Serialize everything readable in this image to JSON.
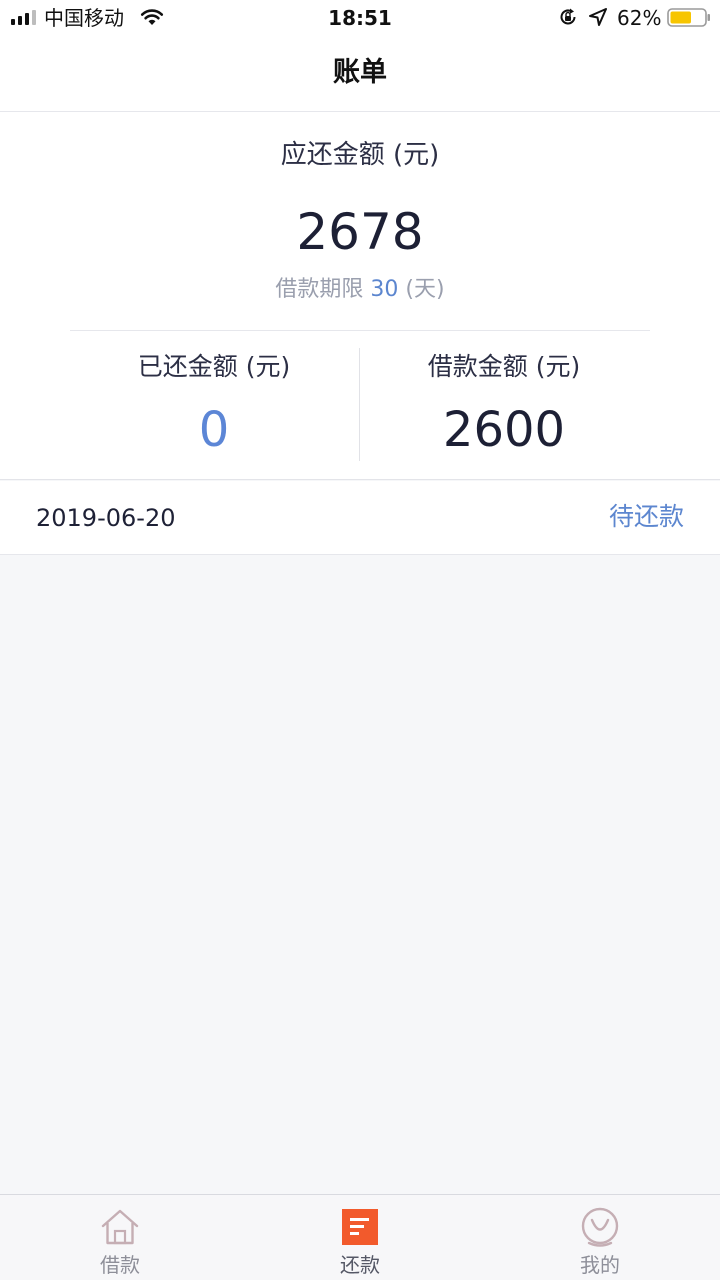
{
  "status_bar": {
    "carrier": "中国移动",
    "time": "18:51",
    "battery_percent": "62%",
    "battery_level": 0.62,
    "icons": [
      "signal-icon",
      "wifi-icon",
      "orientation-lock-icon",
      "location-arrow-icon",
      "battery-icon"
    ]
  },
  "header": {
    "title": "账单"
  },
  "summary": {
    "due_label": "应还金额 (元)",
    "due_amount": "2678",
    "term_prefix": "借款期限 ",
    "term_value": "30",
    "term_suffix": " (天)",
    "repaid_label": "已还金额 (元)",
    "repaid_value": "0",
    "loan_label": "借款金额 (元)",
    "loan_value": "2600"
  },
  "bill": {
    "date": "2019-06-20",
    "status": "待还款"
  },
  "tabs": [
    {
      "label": "借款",
      "icon": "house-icon",
      "active": false
    },
    {
      "label": "还款",
      "icon": "bill-icon",
      "active": true
    },
    {
      "label": "我的",
      "icon": "profile-icon",
      "active": false
    }
  ],
  "colors": {
    "accent_blue": "#5c86cf",
    "active_tab_orange": "#f25a2c",
    "text_dark": "#1e2136",
    "text_muted": "#9a9fae",
    "page_background": "#f6f7f9"
  }
}
